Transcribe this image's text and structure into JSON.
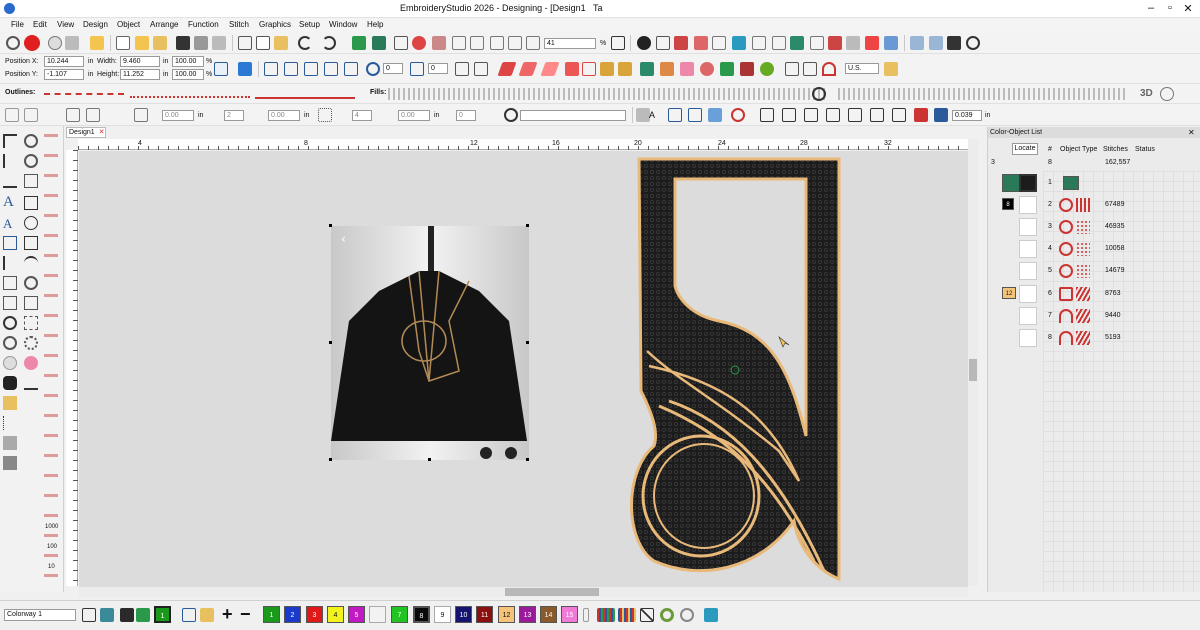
{
  "window": {
    "title": "EmbroideryStudio 2026 - Designing - [Design1",
    "title_suffix": "Ta"
  },
  "menu": [
    "File",
    "Edit",
    "View",
    "Design",
    "Object",
    "Arrange",
    "Function",
    "Stitch",
    "Graphics",
    "Setup",
    "Window",
    "Help"
  ],
  "props": {
    "pos_x_label": "Position X:",
    "pos_x": "10.244",
    "pos_x_unit": "in",
    "pos_y_label": "Position Y:",
    "pos_y": "-1.107",
    "pos_y_unit": "in",
    "width_label": "Width:",
    "width": "9.460",
    "width_unit": "in",
    "height_label": "Height:",
    "height": "11.252",
    "height_unit": "in",
    "scale_w": "100.00",
    "scale_h": "100.00",
    "pct": "%",
    "zoom_value": "41",
    "zoom_pct": "%",
    "stitch_field_a": "0",
    "stitch_field_b": "0",
    "units": "U.S."
  },
  "outlines_label": "Outlines:",
  "fills_label": "Fills:",
  "toolbar4": {
    "val1": "0.00",
    "val2": "2",
    "val3": "0.00",
    "val4": "4",
    "val5": "0.00",
    "val6": "0",
    "unit": "in",
    "unit2": "in",
    "unit3": "in",
    "font_a": "A",
    "spacing": "0.039",
    "spacing_unit": "in",
    "label_3d": "3D"
  },
  "doc_tab": {
    "label": "Design1",
    "close": "✕"
  },
  "ruler_ticks": [
    "4",
    "8",
    "12",
    "16",
    "20",
    "24",
    "28",
    "32"
  ],
  "panel": {
    "title": "Color-Object List",
    "locate": "Locate",
    "columns": [
      "#",
      "Object Type",
      "Stitches",
      "Status"
    ],
    "summary": {
      "colors": "3",
      "objects": "8",
      "stitches": "162,557"
    },
    "groups": [
      {
        "badge": "8",
        "badge_color": "#000000"
      },
      {
        "badge": "12",
        "badge_color": "#f5c47a"
      }
    ],
    "rows": [
      {
        "num": "1",
        "stitches": ""
      },
      {
        "num": "2",
        "stitches": "67489"
      },
      {
        "num": "3",
        "stitches": "46935"
      },
      {
        "num": "4",
        "stitches": "10058"
      },
      {
        "num": "5",
        "stitches": "14679"
      },
      {
        "num": "6",
        "stitches": "8763"
      },
      {
        "num": "7",
        "stitches": "9440"
      },
      {
        "num": "8",
        "stitches": "5193"
      }
    ]
  },
  "colorway": "Colorway 1",
  "swatches": [
    {
      "n": "1",
      "color": "#1a9a1a"
    },
    {
      "n": "2",
      "color": "#1a3acc"
    },
    {
      "n": "3",
      "color": "#e01818"
    },
    {
      "n": "4",
      "color": "#f2f21e"
    },
    {
      "n": "5",
      "color": "#c21ac2"
    },
    {
      "n": "7",
      "color": "#22c422"
    },
    {
      "n": "8",
      "color": "#0a0a0a"
    },
    {
      "n": "9",
      "color": "#ffffff"
    },
    {
      "n": "10",
      "color": "#141470"
    },
    {
      "n": "11",
      "color": "#8a1010"
    },
    {
      "n": "12",
      "color": "#f5c47a"
    },
    {
      "n": "13",
      "color": "#9b1a9b"
    },
    {
      "n": "14",
      "color": "#8a5a2a"
    },
    {
      "n": "15",
      "color": "#f07ad8"
    }
  ],
  "current_swatch": "1",
  "colors": {
    "gold": "#e9b97a",
    "fabric": "#1c1c1c",
    "canvas": "#dcdcdc"
  }
}
